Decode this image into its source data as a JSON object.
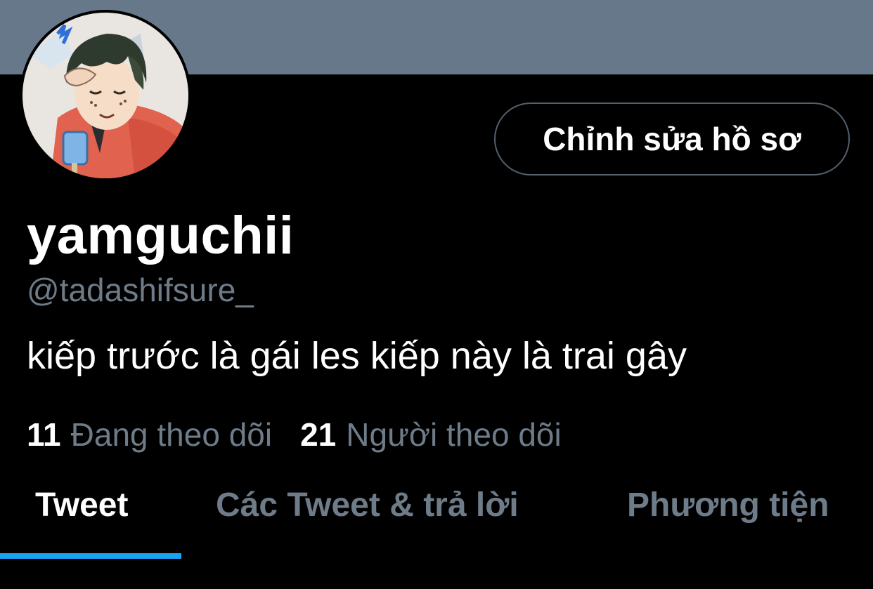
{
  "profile": {
    "display_name": "yamguchii",
    "handle": "@tadashifsure_",
    "bio": "kiếp trước là gái les kiếp này là trai gây",
    "edit_button_label": "Chỉnh sửa hồ sơ",
    "avatar_icon": "avatar-image"
  },
  "stats": {
    "following_count": "11",
    "following_label": "Đang theo dõi",
    "followers_count": "21",
    "followers_label": "Người theo dõi"
  },
  "tabs": [
    {
      "label": "Tweet",
      "active": true
    },
    {
      "label": "Các Tweet & trả lời",
      "active": false
    },
    {
      "label": "Phương tiện",
      "active": false
    }
  ],
  "colors": {
    "background": "#000000",
    "banner": "#67788a",
    "secondary_text": "#6e7b88",
    "accent": "#1da1f2",
    "button_border": "#53606d"
  }
}
